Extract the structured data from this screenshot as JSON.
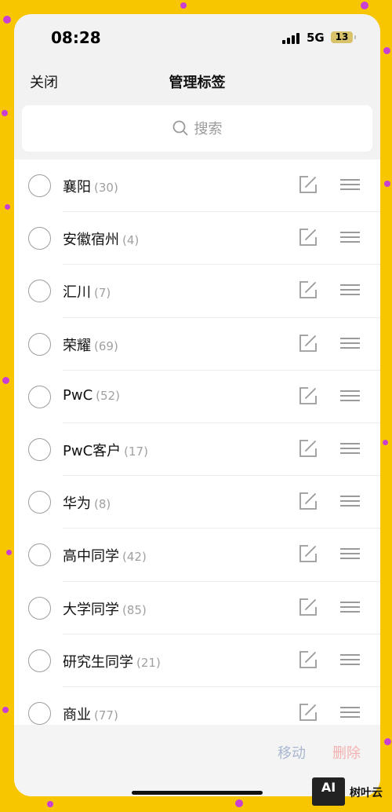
{
  "status_bar": {
    "time": "08:28",
    "network": "5G",
    "battery": "13"
  },
  "nav": {
    "close_label": "关闭",
    "title": "管理标签"
  },
  "search": {
    "placeholder": "搜索"
  },
  "tags": [
    {
      "name": "襄阳",
      "count": "(30)"
    },
    {
      "name": "安徽宿州",
      "count": "(4)"
    },
    {
      "name": "汇川",
      "count": "(7)"
    },
    {
      "name": "荣耀",
      "count": "(69)"
    },
    {
      "name": "PwC",
      "count": "(52)"
    },
    {
      "name": "PwC客户",
      "count": "(17)"
    },
    {
      "name": "华为",
      "count": "(8)"
    },
    {
      "name": "高中同学",
      "count": "(42)"
    },
    {
      "name": "大学同学",
      "count": "(85)"
    },
    {
      "name": "研究生同学",
      "count": "(21)"
    },
    {
      "name": "商业",
      "count": "(77)"
    }
  ],
  "bottom_bar": {
    "move_label": "移动",
    "delete_label": "删除"
  },
  "watermark": {
    "logo_text": "AI",
    "text": "树叶云"
  },
  "colors": {
    "background": "#f7c600",
    "move": "#a9b7d0",
    "delete": "#f3b1b1"
  }
}
